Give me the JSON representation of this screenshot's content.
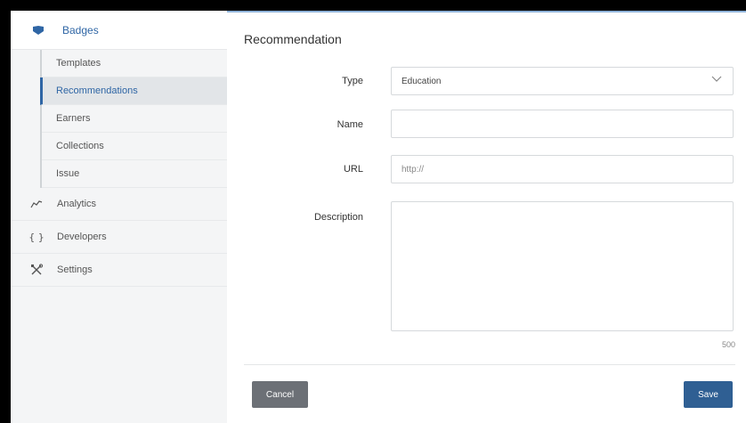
{
  "sidebar": {
    "badges_label": "Badges",
    "sub_items": [
      "Templates",
      "Recommendations",
      "Earners",
      "Collections",
      "Issue"
    ],
    "analytics_label": "Analytics",
    "developers_label": "Developers",
    "developers_icon_text": "{ }",
    "settings_label": "Settings"
  },
  "form": {
    "title": "Recommendation",
    "type_label": "Type",
    "type_value": "Education",
    "name_label": "Name",
    "name_value": "",
    "url_label": "URL",
    "url_placeholder": "http://",
    "description_label": "Description",
    "description_value": "",
    "char_count": "500",
    "cancel_label": "Cancel",
    "save_label": "Save"
  },
  "colors": {
    "accent": "#2f66a5",
    "save_button": "#2f5f93",
    "cancel_button": "#6c7076"
  }
}
